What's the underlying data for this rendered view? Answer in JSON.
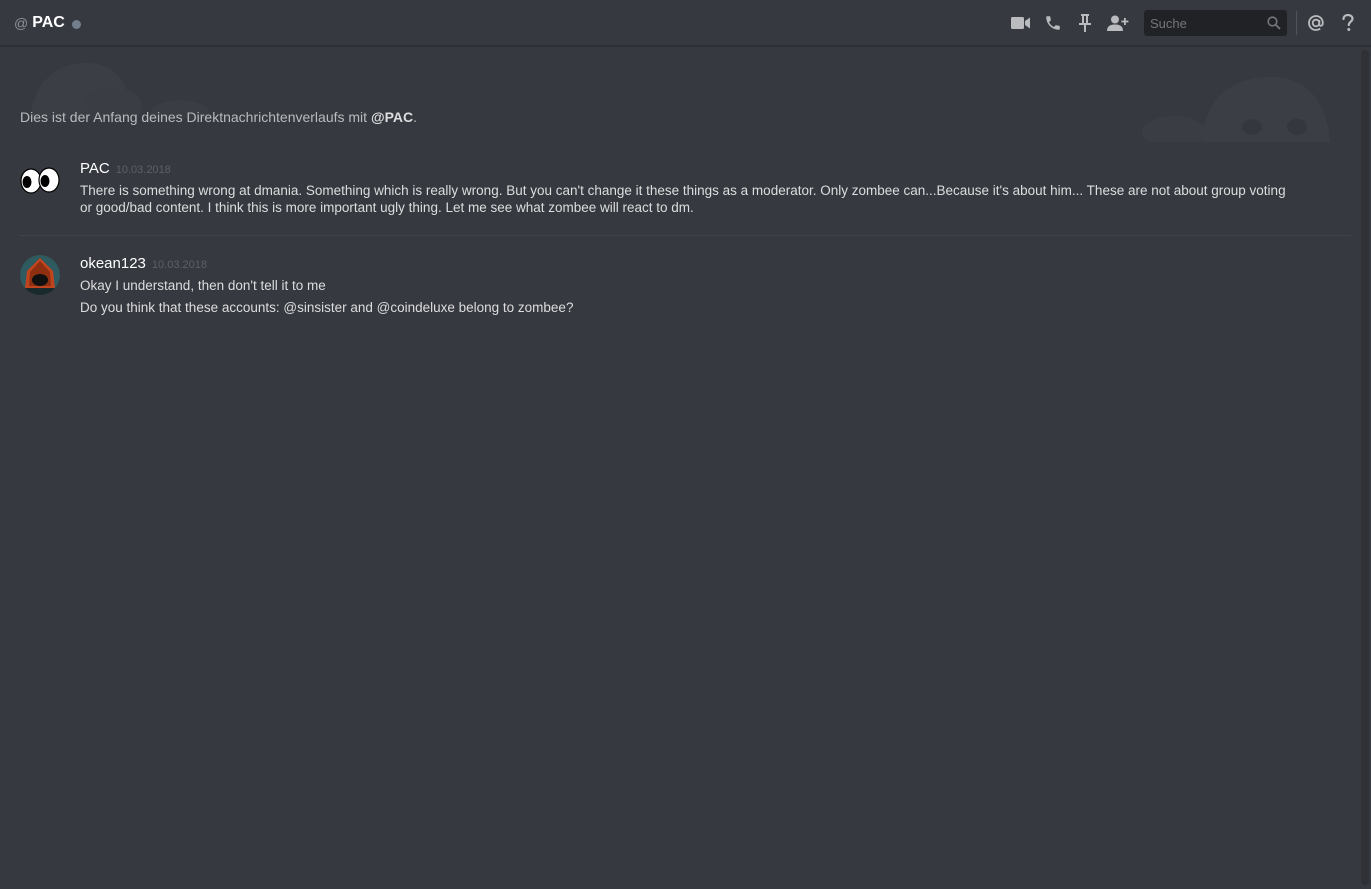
{
  "header": {
    "at_symbol": "@",
    "title": "PAC",
    "status_color": "#747f8d",
    "icons": [
      "video-camera-icon",
      "phone-icon",
      "pin-icon",
      "add-user-icon",
      "mention-icon",
      "help-icon"
    ],
    "search_placeholder": "Suche"
  },
  "intro": {
    "text_before": "Dies ist der Anfang deines Direktnachrichtenverlaufs mit ",
    "name": "@PAC",
    "text_after": "."
  },
  "messages": [
    {
      "author": "PAC",
      "timestamp": "10.03.2018",
      "avatar": "googly-eyes-avatar",
      "lines": [
        "There is something wrong at dmania. Something which is really wrong. But you can't change it these things as a moderator. Only zombee can...Because it's about him... These are not about group voting or good/bad content. I think this is more important ugly thing. Let me see what zombee will react to dm."
      ]
    },
    {
      "author": "okean123",
      "timestamp": "10.03.2018",
      "avatar": "hooded-figure-avatar",
      "lines": [
        "Okay I understand, then don't tell it to me",
        "Do you think that these accounts: @sinsister and @coindeluxe belong to zombee?"
      ]
    }
  ],
  "colors": {
    "background": "#36393f",
    "header_text": "#ffffff",
    "message_text": "#dcddde",
    "muted_text": "#8e9297",
    "search_bg": "#202225"
  }
}
